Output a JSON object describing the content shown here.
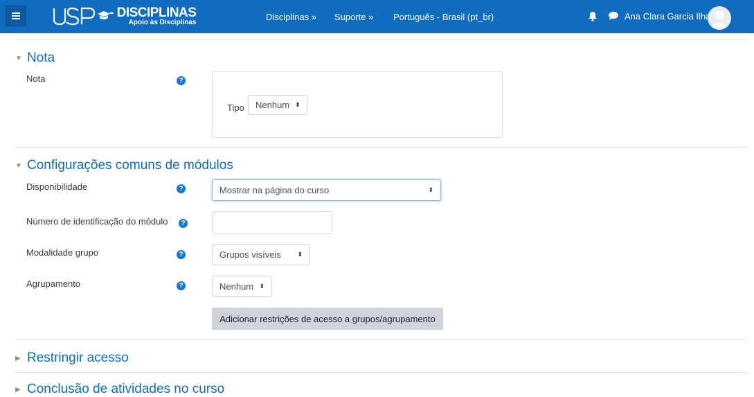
{
  "navbar": {
    "logo_text": "USP",
    "disciplinas": "DISCIPLINAS",
    "disciplinas_sub": "Apoio às Disciplinas",
    "links": [
      "Disciplinas »",
      "Suporte »",
      "Português - Brasil (pt_br)"
    ],
    "user_name": "Ana Clara Garcia Ilha"
  },
  "sections": {
    "nota": {
      "title": "Nota",
      "field_label": "Nota",
      "tipo_label": "Tipo",
      "tipo_value": "Nenhum"
    },
    "common": {
      "title": "Configurações comuns de módulos",
      "disponibilidade_label": "Disponibilidade",
      "disponibilidade_value": "Mostrar na página do curso",
      "idnumber_label": "Número de identificação do módulo",
      "idnumber_value": "",
      "groupmode_label": "Modalidade grupo",
      "groupmode_value": "Grupos visíveis",
      "grouping_label": "Agrupamento",
      "grouping_value": "Nenhum",
      "restrict_button": "Adicionar restrições de acesso a grupos/agrupamento"
    },
    "restrict": {
      "title": "Restringir acesso"
    },
    "completion": {
      "title": "Conclusão de atividades no curso"
    }
  },
  "icons": {
    "help": "?",
    "caret_expanded": "▼",
    "caret_collapsed": "▶",
    "select_arrow": "⬍"
  },
  "colors": {
    "brand": "#0f6cbf",
    "link": "#0f6cbf",
    "help": "#1177d1"
  }
}
